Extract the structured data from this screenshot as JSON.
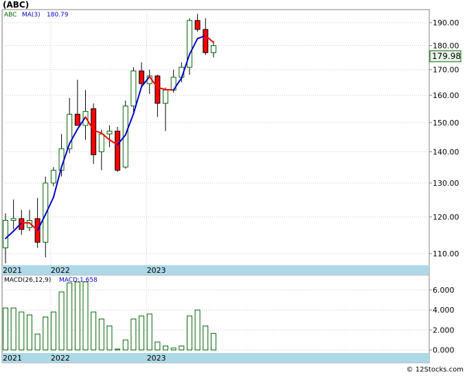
{
  "title": "(ABC)",
  "credit": "© 12Stocks.com",
  "colors": {
    "up_fill": "#ffffff",
    "up_stroke": "#006400",
    "down_fill": "#ff0000",
    "down_stroke": "#000000",
    "ma_blue": "#0000cc",
    "ma_red": "#ff0000",
    "macd_bar": "#006400",
    "date_band": "#add8e6",
    "last_price_box": "#e8f5e8"
  },
  "chart_data": [
    {
      "type": "candlestick",
      "ticker_label": "ABC",
      "indicator_label": "MA(3)",
      "indicator_value": "180.79",
      "last_price_label": "179.98",
      "last_price": 179.98,
      "ylim": [
        107,
        196
      ],
      "y_ticks": [
        "110.00",
        "120.00",
        "130.00",
        "140.00",
        "150.00",
        "160.00",
        "170.00",
        "180.00",
        "190.00"
      ],
      "y_scale": "log",
      "grid": true,
      "x_labels": [
        {
          "label": "2021",
          "index": 0
        },
        {
          "label": "2022",
          "index": 6
        },
        {
          "label": "2023",
          "index": 18
        }
      ],
      "candles": [
        {
          "o": 111.5,
          "h": 121.0,
          "l": 107.5,
          "c": 119.0
        },
        {
          "o": 119.0,
          "h": 125.0,
          "l": 116.5,
          "c": 119.5
        },
        {
          "o": 119.5,
          "h": 122.0,
          "l": 115.0,
          "c": 116.5
        },
        {
          "o": 117.0,
          "h": 122.0,
          "l": 116.0,
          "c": 119.0
        },
        {
          "o": 119.5,
          "h": 125.5,
          "l": 111.5,
          "c": 113.0
        },
        {
          "o": 113.0,
          "h": 132.0,
          "l": 109.0,
          "c": 130.0
        },
        {
          "o": 130.0,
          "h": 135.0,
          "l": 129.0,
          "c": 134.0
        },
        {
          "o": 134.0,
          "h": 146.0,
          "l": 132.0,
          "c": 141.0
        },
        {
          "o": 141.0,
          "h": 159.0,
          "l": 139.5,
          "c": 153.0
        },
        {
          "o": 153.0,
          "h": 166.0,
          "l": 150.5,
          "c": 149.0
        },
        {
          "o": 149.0,
          "h": 162.0,
          "l": 144.0,
          "c": 154.0
        },
        {
          "o": 155.0,
          "h": 157.0,
          "l": 136.0,
          "c": 139.0
        },
        {
          "o": 140.0,
          "h": 147.5,
          "l": 134.0,
          "c": 146.0
        },
        {
          "o": 146.0,
          "h": 149.0,
          "l": 141.5,
          "c": 147.0
        },
        {
          "o": 147.0,
          "h": 148.5,
          "l": 133.5,
          "c": 134.0
        },
        {
          "o": 135.0,
          "h": 158.0,
          "l": 134.5,
          "c": 156.0
        },
        {
          "o": 156.0,
          "h": 171.0,
          "l": 154.0,
          "c": 169.5
        },
        {
          "o": 169.5,
          "h": 173.0,
          "l": 163.0,
          "c": 164.5
        },
        {
          "o": 164.5,
          "h": 170.0,
          "l": 160.5,
          "c": 167.5
        },
        {
          "o": 167.5,
          "h": 168.0,
          "l": 152.0,
          "c": 157.0
        },
        {
          "o": 157.0,
          "h": 163.0,
          "l": 147.0,
          "c": 162.0
        },
        {
          "o": 162.0,
          "h": 170.0,
          "l": 161.0,
          "c": 167.0
        },
        {
          "o": 167.0,
          "h": 173.0,
          "l": 165.0,
          "c": 171.0
        },
        {
          "o": 171.0,
          "h": 192.0,
          "l": 168.0,
          "c": 191.0
        },
        {
          "o": 191.0,
          "h": 194.0,
          "l": 186.0,
          "c": 187.0
        },
        {
          "o": 187.0,
          "h": 192.0,
          "l": 176.0,
          "c": 177.0
        },
        {
          "o": 177.0,
          "h": 182.0,
          "l": 175.0,
          "c": 179.98
        }
      ],
      "ma": [
        114.0,
        116.0,
        118.3,
        118.3,
        116.2,
        120.7,
        125.7,
        135.0,
        142.7,
        147.7,
        152.0,
        147.3,
        146.3,
        144.0,
        142.3,
        145.7,
        153.2,
        163.3,
        167.2,
        163.0,
        162.2,
        162.0,
        166.7,
        176.3,
        183.0,
        184.3,
        181.3
      ],
      "ma_trend": [
        "up",
        "up",
        "up",
        "down",
        "down",
        "up",
        "up",
        "up",
        "up",
        "up",
        "up",
        "down",
        "down",
        "down",
        "down",
        "up",
        "up",
        "up",
        "up",
        "down",
        "down",
        "down",
        "up",
        "up",
        "up",
        "up",
        "down"
      ]
    },
    {
      "type": "bar",
      "indicator_label": "MACD(26,12,9)",
      "value_label": "MACD:1.658",
      "ylim": [
        -0.3,
        7.3
      ],
      "y_ticks": [
        "0.000",
        "2.000",
        "4.000",
        "6.000"
      ],
      "x_labels": [
        {
          "label": "2021",
          "index": 0
        },
        {
          "label": "2022",
          "index": 6
        },
        {
          "label": "2023",
          "index": 18
        }
      ],
      "values": [
        4.2,
        4.2,
        3.8,
        3.5,
        1.6,
        3.3,
        3.8,
        5.8,
        6.7,
        6.8,
        6.8,
        3.8,
        3.1,
        2.4,
        0.1,
        1.0,
        3.1,
        3.4,
        3.6,
        0.8,
        0.4,
        0.2,
        0.4,
        3.4,
        4.0,
        2.4,
        1.658
      ]
    }
  ]
}
